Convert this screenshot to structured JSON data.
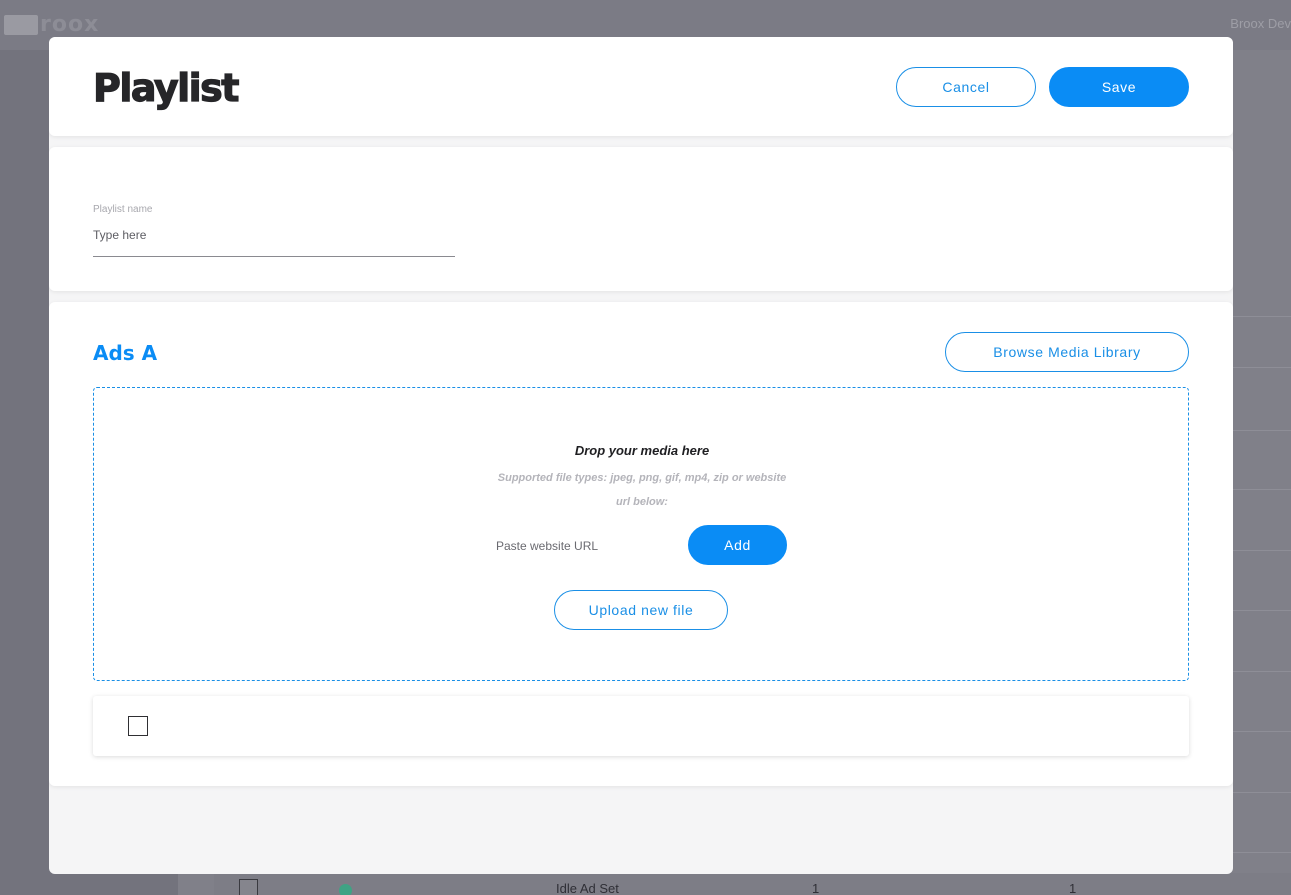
{
  "background": {
    "logo_text": "roox",
    "user_name": "Broox Dev",
    "table_row": {
      "name": "Idle Ad Set",
      "col_a": "1",
      "col_b": "1",
      "status_color": "#3fa384"
    }
  },
  "modal": {
    "title": "Playlist",
    "cancel_label": "Cancel",
    "save_label": "Save"
  },
  "playlist_name": {
    "label": "Playlist name",
    "value": "",
    "placeholder": "Type here"
  },
  "ads_section": {
    "title": "Ads A",
    "browse_label": "Browse Media Library",
    "dropzone": {
      "title": "Drop your media here",
      "subtitle": "Supported file types: jpeg, png, gif, mp4, zip or website url below:",
      "url_placeholder": "Paste website URL",
      "add_label": "Add",
      "upload_label": "Upload new file"
    },
    "media_rows": [
      {
        "checked": false
      }
    ]
  },
  "colors": {
    "accent": "#0a8cf5",
    "title_text": "#262629",
    "overlay": "#7c7c86"
  }
}
